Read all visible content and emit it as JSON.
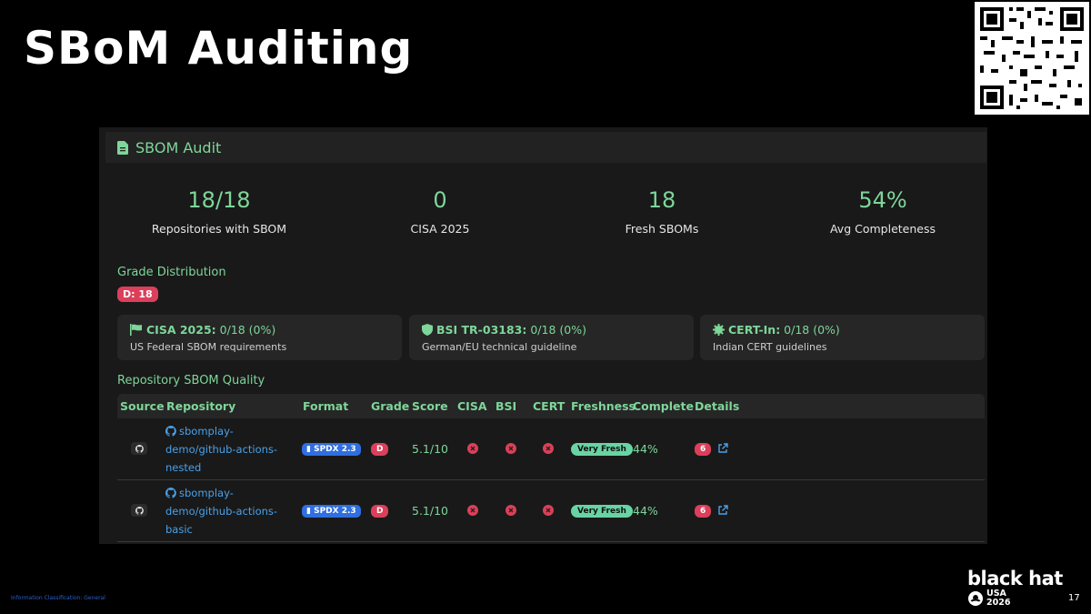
{
  "slide": {
    "title": "SBoM Auditing",
    "page_number": "17",
    "classification": "Information Classification: General"
  },
  "logo": {
    "line1": "black hat",
    "line2": "USA",
    "line3": "2026"
  },
  "panel": {
    "title": "SBOM Audit"
  },
  "stats": [
    {
      "value": "18/18",
      "label": "Repositories with SBOM"
    },
    {
      "value": "0",
      "label": "CISA 2025"
    },
    {
      "value": "18",
      "label": "Fresh SBOMs"
    },
    {
      "value": "54%",
      "label": "Avg Completeness"
    }
  ],
  "grade_distribution": {
    "title": "Grade Distribution",
    "badge": "D: 18"
  },
  "compliance": [
    {
      "icon": "flag-icon",
      "name": "CISA 2025:",
      "value": " 0/18 (0%)",
      "desc": "US Federal SBOM requirements"
    },
    {
      "icon": "shield-icon",
      "name": "BSI TR-03183:",
      "value": " 0/18 (0%)",
      "desc": "German/EU technical guideline"
    },
    {
      "icon": "certificate-icon",
      "name": "CERT-In:",
      "value": " 0/18 (0%)",
      "desc": "Indian CERT guidelines"
    }
  ],
  "quality": {
    "title": "Repository SBOM Quality",
    "columns": [
      "Source",
      "Repository",
      "Format",
      "Grade",
      "Score",
      "CISA",
      "BSI",
      "CERT",
      "Freshness",
      "Complete",
      "Details"
    ],
    "rows": [
      {
        "source_icon": "github-icon",
        "repo_line1": "sbomplay-",
        "repo_line2": "demo/github-actions-",
        "repo_line3": "nested",
        "format": "SPDX 2.3",
        "grade": "D",
        "score": "5.1/10",
        "freshness": "Very Fresh",
        "complete": "44%",
        "details_count": "6"
      },
      {
        "source_icon": "github-icon",
        "repo_line1": "sbomplay-",
        "repo_line2": "demo/github-actions-",
        "repo_line3": "basic",
        "format": "SPDX 2.3",
        "grade": "D",
        "score": "5.1/10",
        "freshness": "Very Fresh",
        "complete": "44%",
        "details_count": "6"
      }
    ]
  },
  "colors": {
    "accent_green": "#7ed69a",
    "danger_red": "#dc3f5a",
    "link_blue": "#4aa0e8",
    "format_blue": "#2f6fe0",
    "fresh_teal": "#68d4a4"
  }
}
